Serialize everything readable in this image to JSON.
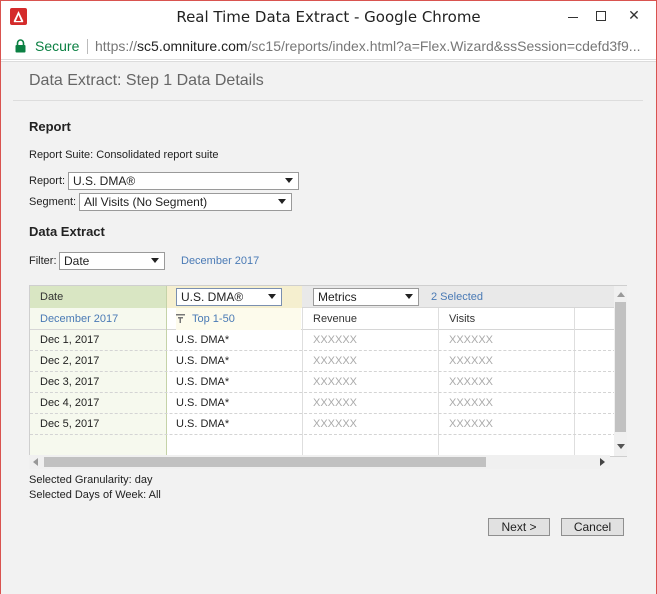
{
  "window": {
    "title": "Real Time Data Extract - Google Chrome",
    "close_glyph": "✕",
    "colors": {
      "accent_red": "#d42b2b",
      "secure_green": "#0b8043",
      "link_blue": "#4a7ab5"
    }
  },
  "addressbar": {
    "secure_label": "Secure",
    "url_scheme": "https://",
    "url_host": "sc5.omniture.com",
    "url_rest": "/sc15/reports/index.html?a=Flex.Wizard&ssSession=cdefd3f9..."
  },
  "page": {
    "title": "Data Extract: Step 1 Data Details"
  },
  "report": {
    "heading": "Report",
    "suite_label": "Report Suite: Consolidated report suite",
    "report_label": "Report:",
    "report_value": "U.S. DMA®",
    "segment_label": "Segment:",
    "segment_value": "All Visits (No Segment)"
  },
  "extract": {
    "heading": "Data Extract",
    "filter_label": "Filter:",
    "filter_value": "Date",
    "filter_period": "December 2017"
  },
  "grid": {
    "header_date": "Date",
    "dimension_select": "U.S. DMA®",
    "metrics_select": "Metrics",
    "metrics_selected": "2 Selected",
    "sub_date": "December 2017",
    "sub_dimension": "Top 1-50",
    "columns": [
      "Revenue",
      "Visits"
    ],
    "rows": [
      {
        "date": "Dec 1, 2017",
        "dma": "U.S. DMA*",
        "revenue": "XXXXXX",
        "visits": "XXXXXX"
      },
      {
        "date": "Dec 2, 2017",
        "dma": "U.S. DMA*",
        "revenue": "XXXXXX",
        "visits": "XXXXXX"
      },
      {
        "date": "Dec 3, 2017",
        "dma": "U.S. DMA*",
        "revenue": "XXXXXX",
        "visits": "XXXXXX"
      },
      {
        "date": "Dec 4, 2017",
        "dma": "U.S. DMA*",
        "revenue": "XXXXXX",
        "visits": "XXXXXX"
      },
      {
        "date": "Dec 5, 2017",
        "dma": "U.S. DMA*",
        "revenue": "XXXXXX",
        "visits": "XXXXXX"
      }
    ]
  },
  "summary": {
    "granularity": "Selected Granularity: day",
    "days_of_week": "Selected Days of Week: All"
  },
  "footer": {
    "next_label": "Next  >",
    "cancel_label": "Cancel"
  }
}
